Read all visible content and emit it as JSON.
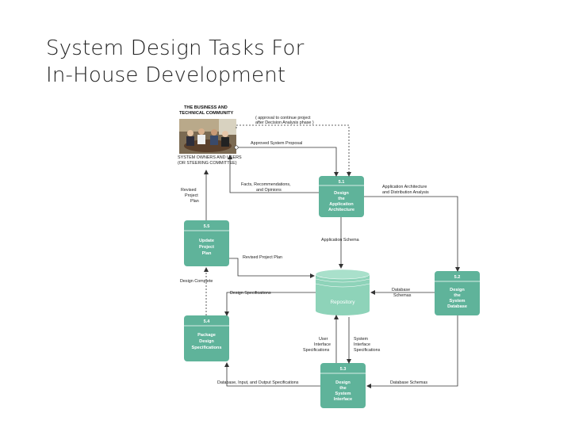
{
  "title": {
    "line1": "System Design Tasks For",
    "line2": "In-House Development"
  },
  "external": {
    "top_label_1": "THE BUSINESS AND",
    "top_label_2": "TECHNICAL COMMUNITY",
    "bottom_label_1": "SYSTEM OWNERS AND USERS",
    "bottom_label_2": "(OR STEERING COMMITTEE)"
  },
  "processes": {
    "p51": {
      "id": "5.1",
      "l1": "Design",
      "l2": "the",
      "l3": "Application",
      "l4": "Architecture"
    },
    "p52": {
      "id": "5.2",
      "l1": "Design",
      "l2": "the",
      "l3": "System",
      "l4": "Database"
    },
    "p53": {
      "id": "5.3",
      "l1": "Design",
      "l2": "the",
      "l3": "System",
      "l4": "Interface"
    },
    "p54": {
      "id": "5.4",
      "l1": "Package",
      "l2": "Design",
      "l3": "Specifications"
    },
    "p55": {
      "id": "5.5",
      "l1": "Update",
      "l2": "Project",
      "l3": "Plan"
    }
  },
  "repository": {
    "label": "Repository"
  },
  "flows": {
    "approval_1": "( approval to continue project",
    "approval_2": "after Decision Analysis phase )",
    "approved_proposal": "Approved System Proposal",
    "facts_1": "Facts, Recommendations,",
    "facts_2": "and Opinions",
    "arch_1": "Application Architecture",
    "arch_2": "and Distribution Analysis",
    "revised_1": "Revised",
    "revised_2": "Project",
    "revised_3": "Plan",
    "app_schema": "Application Schema",
    "revised_pp": "Revised Project Plan",
    "design_complete": "Design Complete",
    "design_specs": "Design Specifications",
    "db_schemas_1": "Database",
    "db_schemas_2": "Schemas",
    "user_if_1": "User",
    "user_if_2": "Interface",
    "user_if_3": "Specifications",
    "sys_if_1": "System",
    "sys_if_2": "Interface",
    "sys_if_3": "Specifications",
    "ddio_specs": "Database, Input, and Output Specifications",
    "db_schemas_bottom": "Database Schemas"
  },
  "colors": {
    "process_fill": "#5fb39a",
    "process_header": "#4fa589",
    "repository_fill": "#8ed3b9",
    "line": "#333333"
  }
}
